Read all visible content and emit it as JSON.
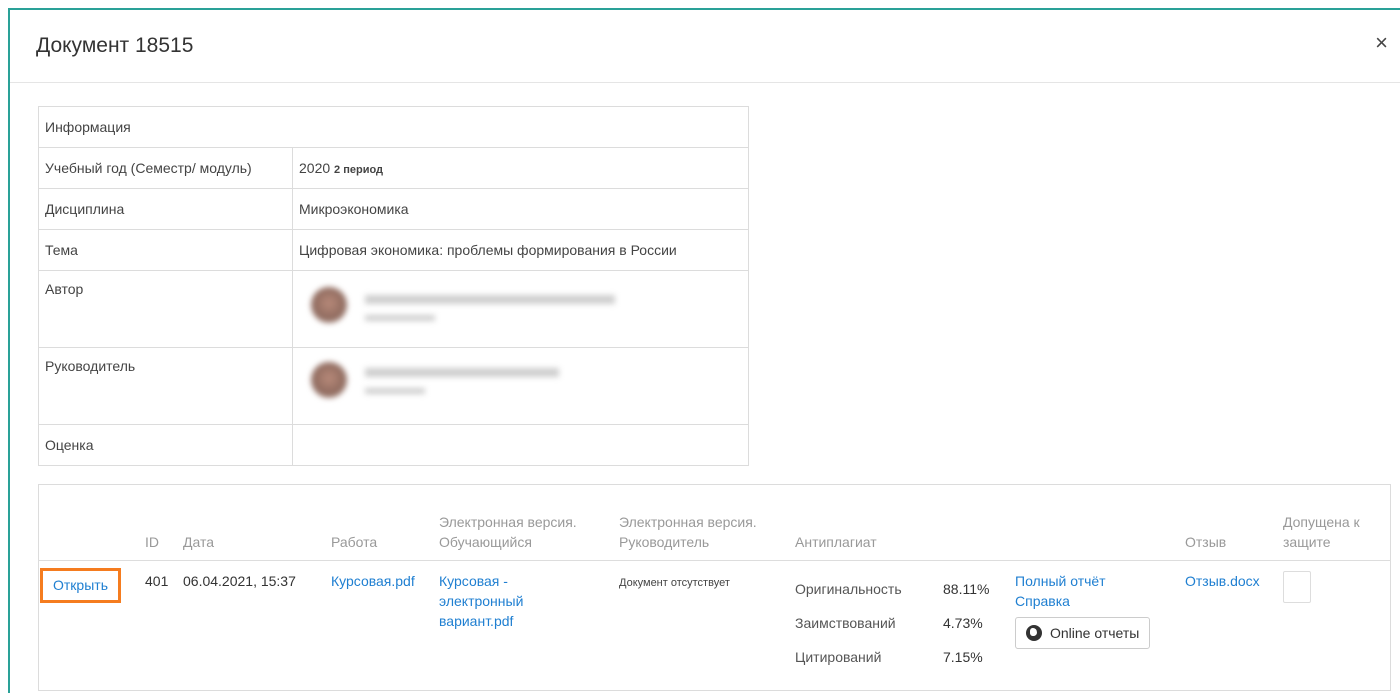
{
  "modal": {
    "title": "Документ 18515",
    "close_label": "×"
  },
  "info": {
    "heading": "Информация",
    "rows": [
      {
        "label": "Учебный год (Семестр/ модуль)",
        "value": "2020",
        "value_small": "2 период"
      },
      {
        "label": "Дисциплина",
        "value": "Микроэкономика"
      },
      {
        "label": "Тема",
        "value": "Цифровая экономика: проблемы формирования в России"
      },
      {
        "label": "Автор"
      },
      {
        "label": "Руководитель"
      },
      {
        "label": "Оценка",
        "value": ""
      }
    ]
  },
  "docs": {
    "headers": {
      "id": "ID",
      "date": "Дата",
      "work": "Работа",
      "ev_student_1": "Электронная версия.",
      "ev_student_2": "Обучающийся",
      "ev_teacher_1": "Электронная версия.",
      "ev_teacher_2": "Руководитель",
      "antiplag": "Антиплагиат",
      "review": "Отзыв",
      "admitted_1": "Допущена к",
      "admitted_2": "защите"
    },
    "row": {
      "open": "Открыть",
      "id": "401",
      "date": "06.04.2021, 15:37",
      "work": "Курсовая.pdf",
      "ev_student_1": "Курсовая -",
      "ev_student_2": "электронный",
      "ev_student_3": "вариант.pdf",
      "ev_teacher": "Документ отсутствует",
      "originality_label": "Оригинальность",
      "originality_value": "88.11%",
      "borrowing_label": "Заимствований",
      "borrowing_value": "4.73%",
      "citation_label": "Цитирований",
      "citation_value": "7.15%",
      "full_report": "Полный отчёт",
      "help": "Справка",
      "online_reports": "Online отчеты",
      "review_file": "Отзыв.docx"
    }
  },
  "colors": {
    "link": "#1f7fd1",
    "highlight": "#f57c1f",
    "frame": "#2aa198"
  }
}
